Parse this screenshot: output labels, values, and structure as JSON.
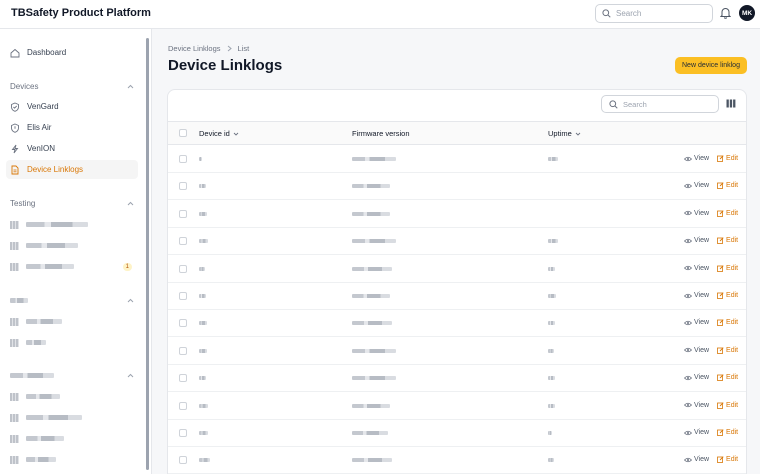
{
  "header": {
    "title": "TBSafety Product Platform",
    "search_placeholder": "Search",
    "avatar_initials": "MK"
  },
  "sidebar": {
    "dashboard": "Dashboard",
    "devices_group": "Devices",
    "devices": [
      "VenGard",
      "Elis Air",
      "VenION",
      "Device Linklogs"
    ],
    "testing_group": "Testing",
    "testing_badge": "1"
  },
  "breadcrumb": {
    "first": "Device Linklogs",
    "second": "List"
  },
  "page": {
    "title": "Device Linklogs",
    "new_button": "New device linklog"
  },
  "table": {
    "search_placeholder": "Search",
    "columns": {
      "device_id": "Device id",
      "firmware": "Firmware version",
      "uptime": "Uptime"
    },
    "view_label": "View",
    "edit_label": "Edit",
    "row_count": 12
  },
  "colors": {
    "accent": "#d97706",
    "button": "#fbbf24"
  }
}
